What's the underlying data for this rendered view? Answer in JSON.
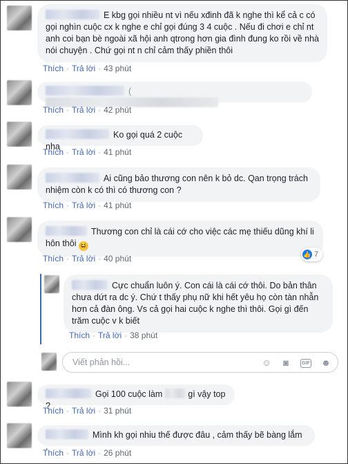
{
  "comments": [
    {
      "text": "E kbg gọi nhiều nt vì nếu xđinh đã k nghe thì kể cả c có gọi nghìn cuộc cx k nghe e chỉ gọi đúng 3 4 cuộc . Nếu đi chơi e chỉ nt anh coi bạn bè ngoài xã hội anh qtrong hơn gia đình đung ko rồi về nhà nói chuyện . Chứ gọi nt n chỉ cảm thấy phiền thôi",
      "like": "Thích",
      "reply": "Trả lời",
      "time": "43 phút"
    },
    {
      "text": "",
      "like": "Thích",
      "reply": "Trả lời",
      "time": "42 phút"
    },
    {
      "text": "Ko gọi quá 2 cuộc nha",
      "like": "Thích",
      "reply": "Trả lời",
      "time": "41 phút"
    },
    {
      "text": "Ai cũng bảo thương con nên k bỏ dc. Qan trọng trách nhiệm còn k có thì có thương con ?",
      "like": "Thích",
      "reply": "Trả lời",
      "time": "41 phút"
    },
    {
      "text": "Thương con chỉ là cái cớ cho việc các mẹ thiếu dũng khí li hôn thôi",
      "emoji": "😆",
      "like": "Thích",
      "reply": "Trả lời",
      "time": "40 phút",
      "reaction_count": "7"
    },
    {
      "text": "Cực chuẩn luôn ý. Con cái là cái cớ thôi. Do bản thân chưa dứt ra dc ý. Chứ t thấy phụ nữ khi hết yêu họ còn tàn nhẫn hơn cả đàn ông. Vs cả gọi hai cuộc k nghe thì thôi. Gọi gì đến trăm cuộc v k biết",
      "like": "Thích",
      "reply": "Trả lời",
      "time": "38 phút"
    },
    {
      "text_before": "Gọi 100 cuộc làm",
      "text_after": "gì vậy top ?",
      "like": "Thích",
      "reply": "Trả lời",
      "time": "31 phút"
    },
    {
      "text": "Mình kh gọi nhiu thế được đâu , cảm thấy bẽ bàng lắm .",
      "like": "Thích",
      "reply": "Trả lời",
      "time": "26 phút"
    }
  ],
  "reply_box": {
    "placeholder": "Viết phản hồi..."
  },
  "colors": {
    "link": "#4267b2",
    "bubble": "#f2f3f5",
    "thread": "#4267b2"
  }
}
